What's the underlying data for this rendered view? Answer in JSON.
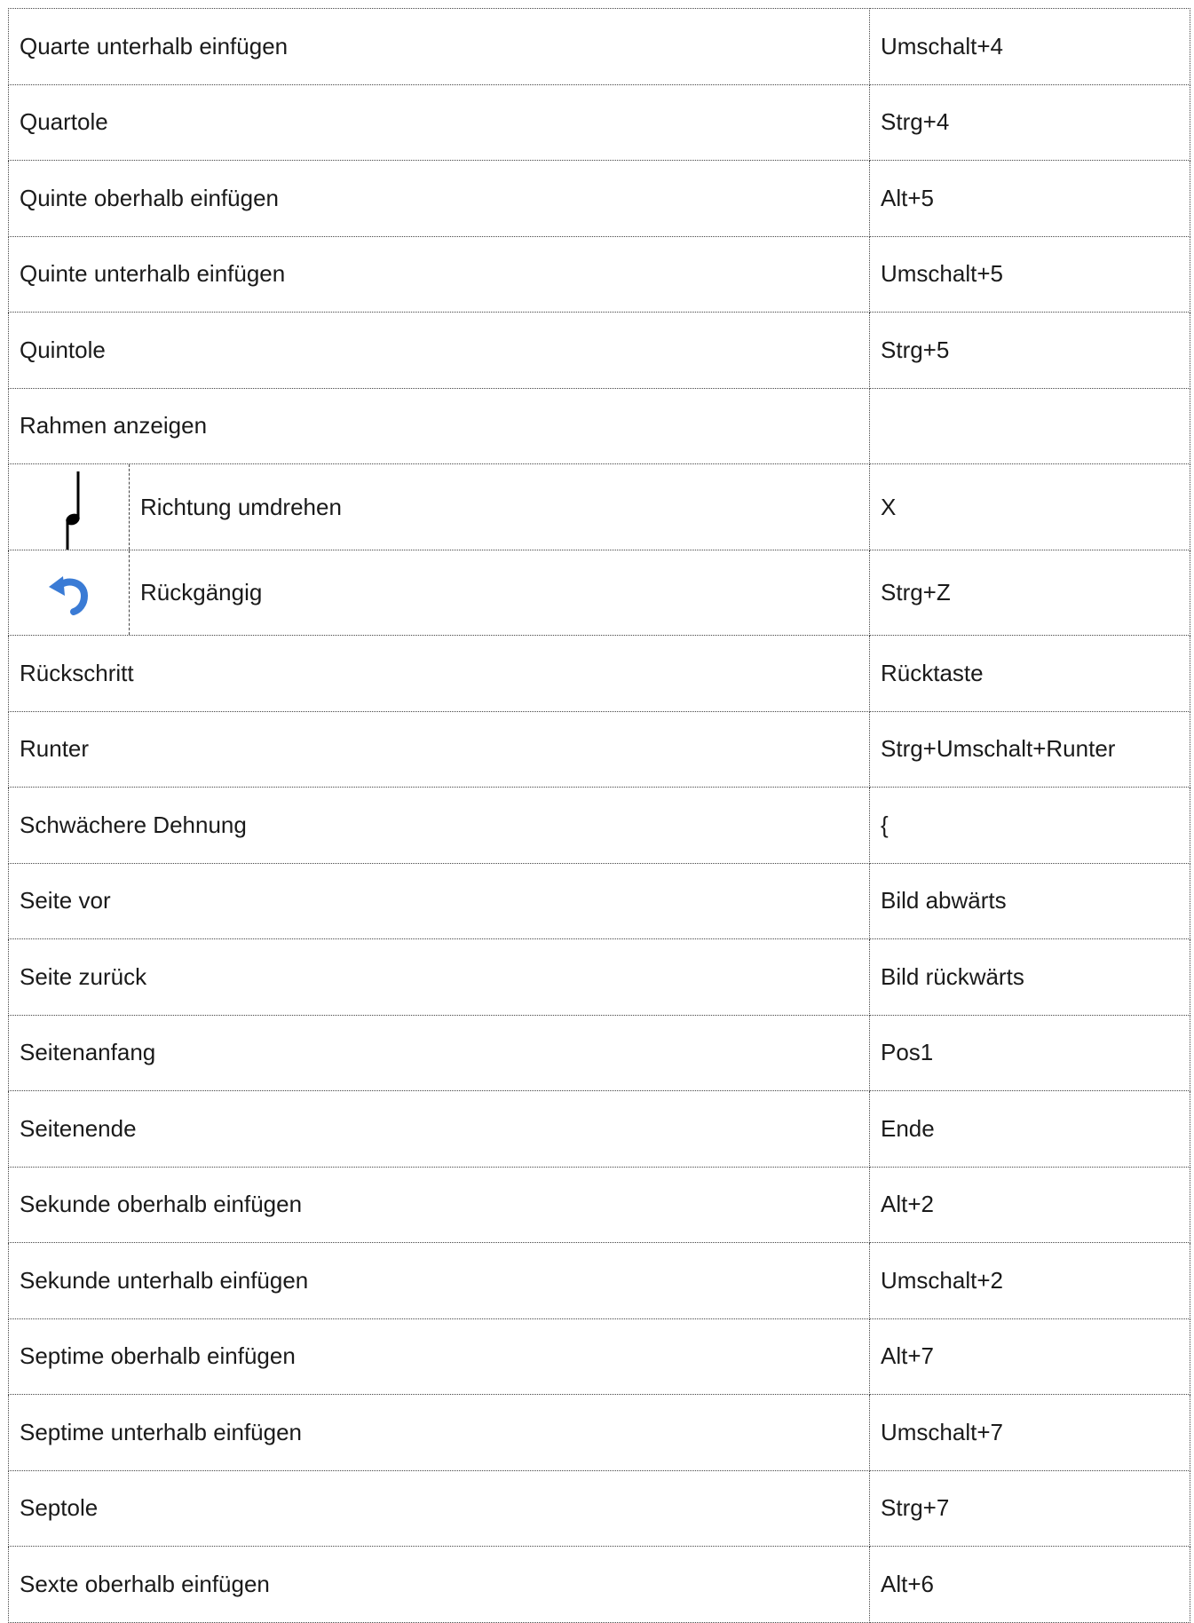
{
  "rows": [
    {
      "action": "Quarte unterhalb einfügen",
      "shortcut": "Umschalt+4"
    },
    {
      "action": "Quartole",
      "shortcut": "Strg+4"
    },
    {
      "action": "Quinte oberhalb einfügen",
      "shortcut": "Alt+5"
    },
    {
      "action": "Quinte unterhalb einfügen",
      "shortcut": "Umschalt+5"
    },
    {
      "action": "Quintole",
      "shortcut": "Strg+5"
    },
    {
      "action": "Rahmen anzeigen",
      "shortcut": ""
    },
    {
      "action": "Richtung umdrehen",
      "shortcut": "X",
      "icon": "note-stem-flip-icon"
    },
    {
      "action": "Rückgängig",
      "shortcut": "Strg+Z",
      "icon": "undo-icon"
    },
    {
      "action": "Rückschritt",
      "shortcut": "Rücktaste"
    },
    {
      "action": "Runter",
      "shortcut": "Strg+Umschalt+Runter"
    },
    {
      "action": "Schwächere Dehnung",
      "shortcut": "{"
    },
    {
      "action": "Seite vor",
      "shortcut": "Bild abwärts"
    },
    {
      "action": "Seite zurück",
      "shortcut": "Bild rückwärts"
    },
    {
      "action": "Seitenanfang",
      "shortcut": "Pos1"
    },
    {
      "action": "Seitenende",
      "shortcut": "Ende"
    },
    {
      "action": "Sekunde oberhalb einfügen",
      "shortcut": "Alt+2"
    },
    {
      "action": "Sekunde unterhalb einfügen",
      "shortcut": "Umschalt+2"
    },
    {
      "action": "Septime oberhalb einfügen",
      "shortcut": "Alt+7"
    },
    {
      "action": "Septime unterhalb einfügen",
      "shortcut": "Umschalt+7"
    },
    {
      "action": "Septole",
      "shortcut": "Strg+7"
    },
    {
      "action": "Sexte oberhalb einfügen",
      "shortcut": "Alt+6"
    }
  ],
  "colors": {
    "undo_icon": "#3a7bd5",
    "note_icon": "#000000",
    "border": "#444444"
  }
}
